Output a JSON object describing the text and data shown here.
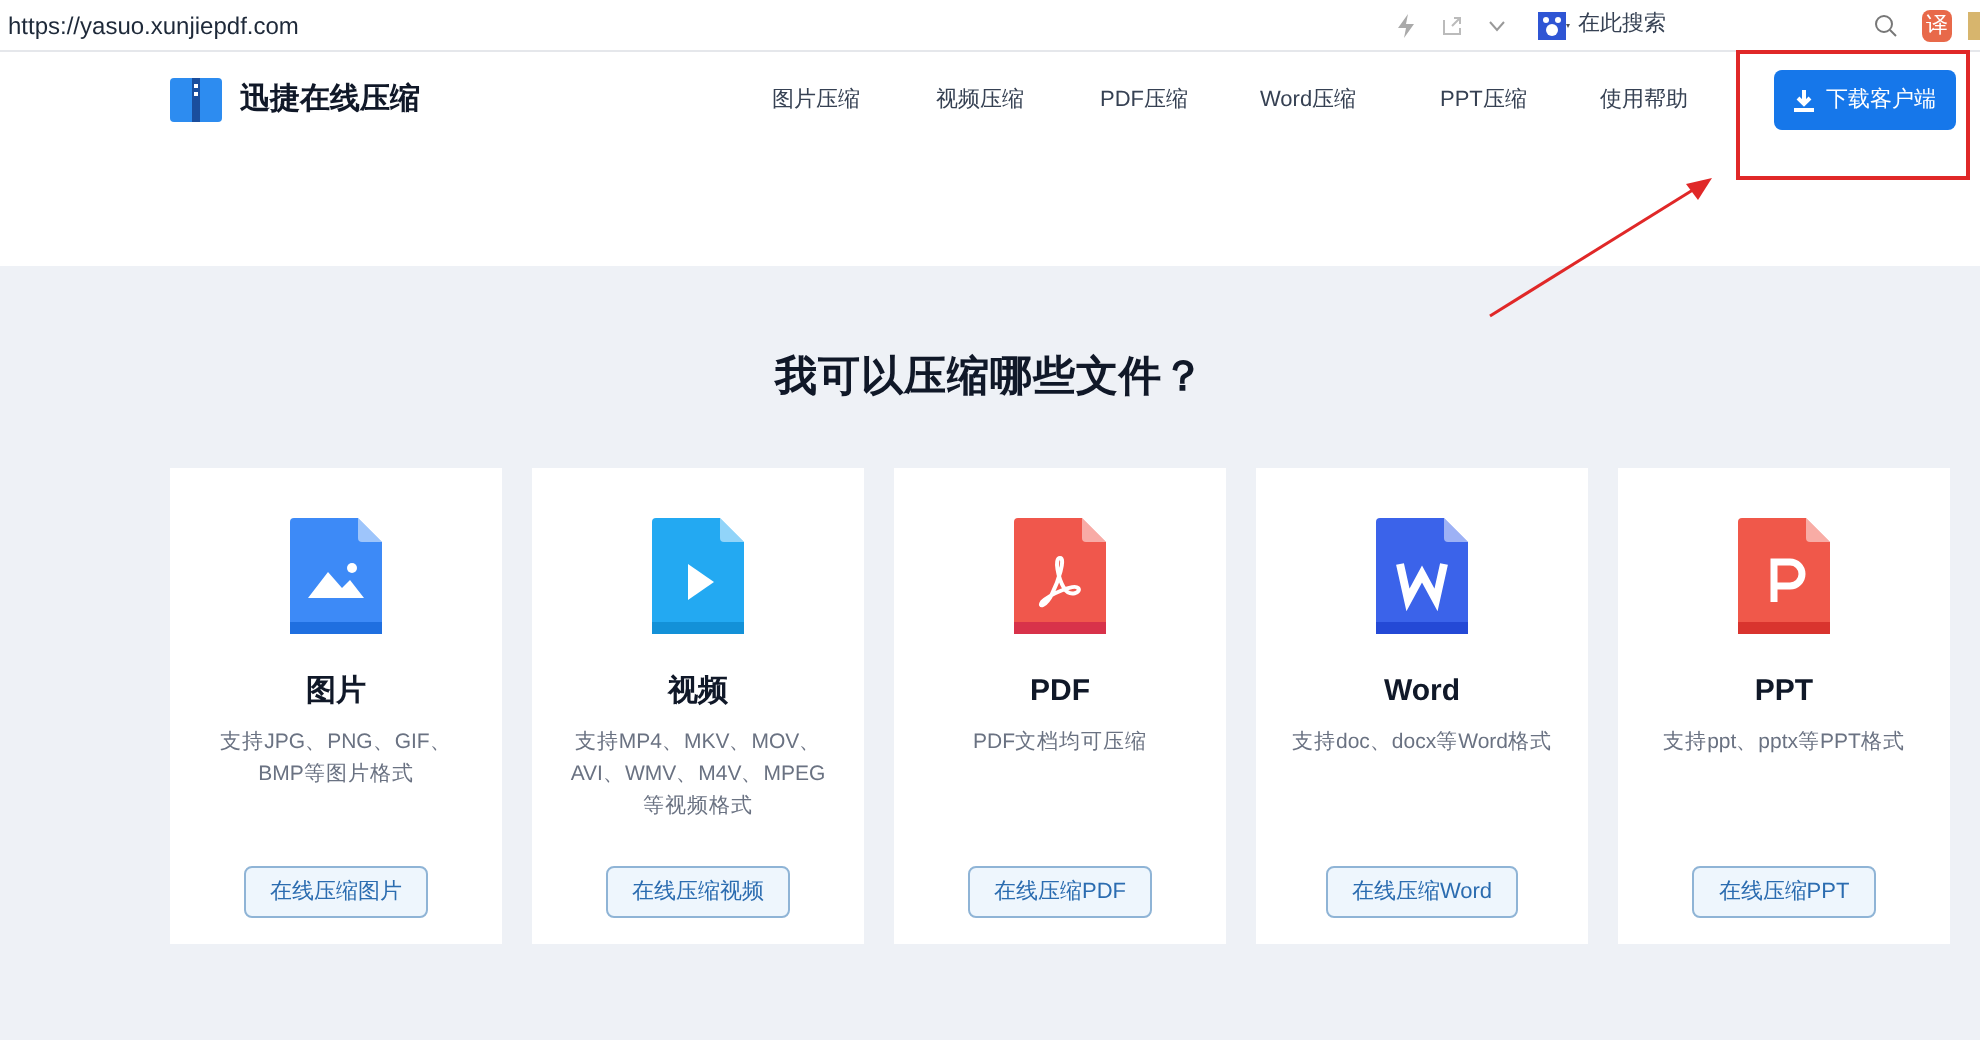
{
  "browser": {
    "url": "https://yasuo.xunjiepdf.com",
    "search": {
      "placeholder": "在此搜索"
    },
    "translate_label": "译"
  },
  "header": {
    "logo_text": "迅捷在线压缩",
    "nav": [
      {
        "label": "图片压缩"
      },
      {
        "label": "视频压缩"
      },
      {
        "label": "PDF压缩"
      },
      {
        "label": "Word压缩"
      },
      {
        "label": "PPT压缩"
      },
      {
        "label": "使用帮助"
      }
    ],
    "download_button": "下载客户端"
  },
  "section": {
    "title": "我可以压缩哪些文件？",
    "cards": [
      {
        "kind": "image",
        "title": "图片",
        "description": "支持JPG、PNG、GIF、BMP等图片格式",
        "button": "在线压缩图片"
      },
      {
        "kind": "video",
        "title": "视频",
        "description": "支持MP4、MKV、MOV、AVI、WMV、M4V、MPEG等视频格式",
        "button": "在线压缩视频"
      },
      {
        "kind": "pdf",
        "title": "PDF",
        "description": "PDF文档均可压缩",
        "button": "在线压缩PDF"
      },
      {
        "kind": "word",
        "title": "Word",
        "description": "支持doc、docx等Word格式",
        "button": "在线压缩Word"
      },
      {
        "kind": "ppt",
        "title": "PPT",
        "description": "支持ppt、pptx等PPT格式",
        "button": "在线压缩PPT"
      }
    ]
  }
}
